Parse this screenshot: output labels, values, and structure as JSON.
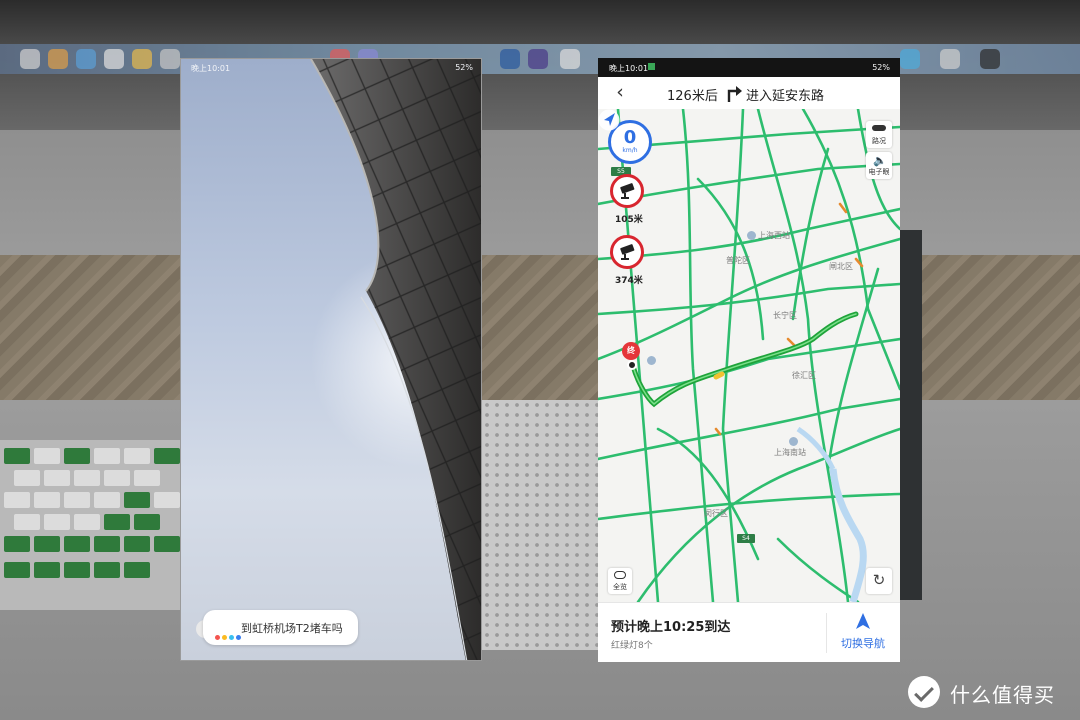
{
  "left_phone": {
    "status_time": "晚上10:01",
    "status_battery": "52%",
    "voice_query": "到虹桥机场T2堵车吗",
    "assistant_dot_colors": [
      "#f4544f",
      "#fbbb22",
      "#39c0f0",
      "#3a7ef0"
    ]
  },
  "right_phone": {
    "status_time": "晚上10:01",
    "status_battery": "52%",
    "nav": {
      "back_icon": "back-arrow-icon",
      "distance": "126米后",
      "turn_icon": "turn-right-icon",
      "road": "进入延安东路"
    },
    "map": {
      "speed_value": "0",
      "speed_unit": "km/h",
      "route_shield_s5": "S5",
      "route_shield_s4": "S4",
      "cameras": [
        {
          "distance": "105米",
          "icon": "speed-camera-icon"
        },
        {
          "distance": "374米",
          "icon": "speed-camera-icon"
        }
      ],
      "traffic_button": "路况",
      "e_eye_button": "电子眼",
      "overview_button": "全览",
      "refresh_icon": "refresh-icon",
      "destination_badge": "终",
      "labels": {
        "shanghai_west": "上海西站",
        "putuo": "普陀区",
        "zhabei": "闸北区",
        "changning": "长宁区",
        "xuhui": "徐汇区",
        "shanghai_south": "上海南站",
        "minhang": "闵行区"
      }
    },
    "bottom": {
      "eta": "预计晚上10:25到达",
      "traffic_lights": "红绿灯8个",
      "switch_nav": "切换导航"
    },
    "colors": {
      "route_green": "#1fa33a",
      "road_green": "#2dbd6e",
      "accent_blue": "#2f6fe2",
      "camera_red": "#d8262f"
    }
  },
  "watermark": {
    "text": "什么值得买"
  }
}
